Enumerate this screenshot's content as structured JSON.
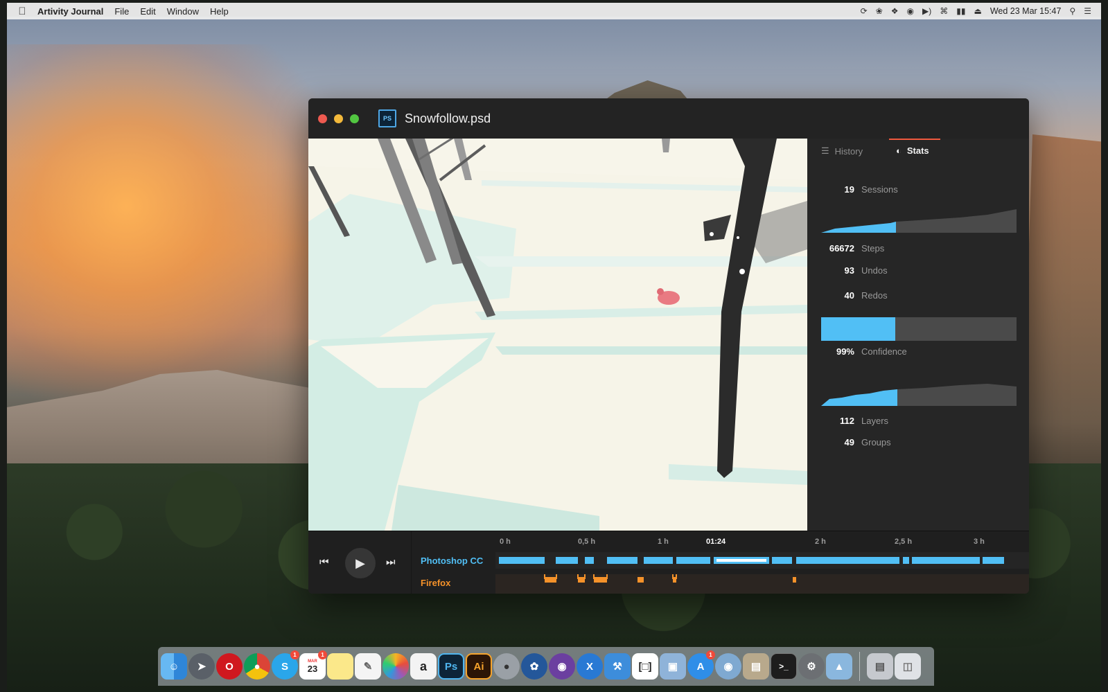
{
  "menubar": {
    "app_name": "Artivity Journal",
    "menus": [
      "File",
      "Edit",
      "Window",
      "Help"
    ],
    "clock": "Wed 23 Mar  15:47",
    "status_icons": [
      "sync-icon",
      "butterfly-icon",
      "dropbox-icon",
      "creative-cloud-icon",
      "volume-icon",
      "wifi-icon",
      "battery-icon",
      "eject-icon"
    ]
  },
  "window": {
    "title": "Snowfollow.psd",
    "file_icon": "PS"
  },
  "panel": {
    "tabs": [
      {
        "label": "History",
        "icon": "list-icon",
        "active": false
      },
      {
        "label": "Stats",
        "icon": "pie-icon",
        "active": true
      }
    ],
    "stats": {
      "sessions": {
        "value": "19",
        "label": "Sessions"
      },
      "steps": {
        "value": "66672",
        "label": "Steps"
      },
      "undos": {
        "value": "93",
        "label": "Undos"
      },
      "redos": {
        "value": "40",
        "label": "Redos"
      },
      "confidence": {
        "value": "99%",
        "label": "Confidence",
        "fraction": 0.38
      },
      "layers": {
        "value": "112",
        "label": "Layers"
      },
      "groups": {
        "value": "49",
        "label": "Groups"
      }
    },
    "sparkline_progress": {
      "sessions": 0.38,
      "layers": 0.39
    },
    "colors": {
      "accent_blue": "#51bff5",
      "tab_underline": "#f0593e",
      "firefox_orange": "#f5922a"
    }
  },
  "timeline": {
    "ruler": [
      "0 h",
      "0,5 h",
      "1 h",
      "01:24",
      "2 h",
      "2,5 h",
      "3 h"
    ],
    "current_time": "01:24",
    "tracks": [
      {
        "name": "Photoshop CC",
        "color": "#51bff5"
      },
      {
        "name": "Firefox",
        "color": "#f5922a"
      }
    ]
  },
  "dock": {
    "apps": [
      "finder-icon",
      "launchpad-icon",
      "opera-icon",
      "chrome-icon",
      "skype-icon",
      "calendar-icon",
      "notes-icon",
      "textedit-icon",
      "photos-icon",
      "amazon-icon",
      "photoshop-icon",
      "illustrator-icon",
      "bomb-icon",
      "sourcetree-icon",
      "github-icon",
      "xcode-icon",
      "xcode-build-icon",
      "bracket-icon",
      "virtualbox-icon",
      "appstore-icon",
      "lock-icon",
      "archive-icon",
      "terminal-icon",
      "system-preferences-icon",
      "preview-icon",
      "downloads-icon",
      "trash-icon"
    ],
    "labels": {
      "photoshop": "Ps",
      "illustrator": "Ai",
      "skype": "S",
      "amazon": "a",
      "calendar": "23",
      "calendar_month": "MAR",
      "xcode": "X"
    },
    "badges": {
      "skype": "1",
      "calendar": "1",
      "appstore": "1"
    }
  }
}
